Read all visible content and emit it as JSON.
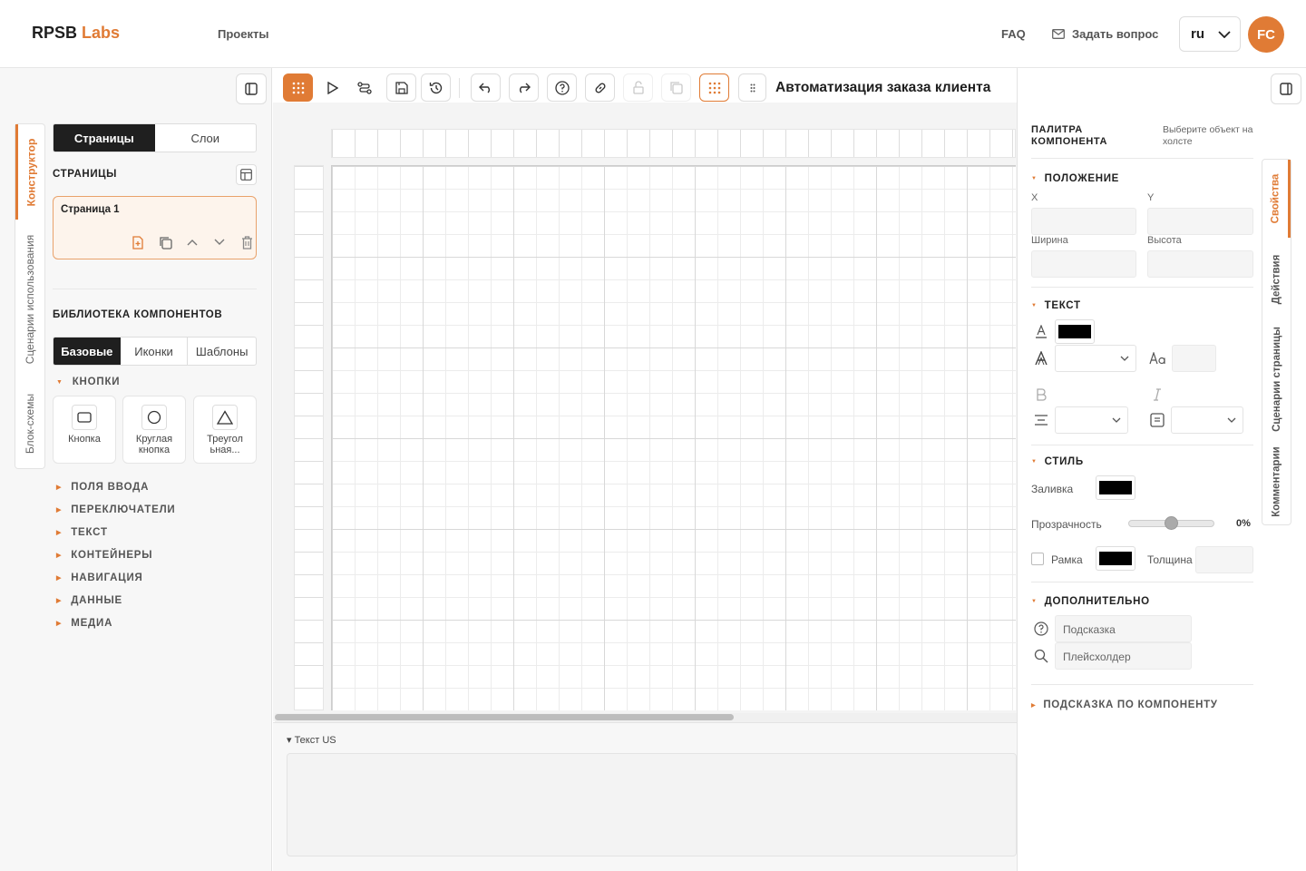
{
  "header": {
    "logo_main": "RPSB",
    "logo_accent": "Labs",
    "nav_projects": "Проекты",
    "faq": "FAQ",
    "ask": "Задать вопрос",
    "lang": "ru",
    "avatar": "FC"
  },
  "left": {
    "vtabs": [
      "Конструктор",
      "Сценарии использования",
      "Блок-схемы"
    ],
    "seg_pages": "Страницы",
    "seg_layers": "Слои",
    "pages_title": "СТРАНИЦЫ",
    "page1": "Страница 1",
    "library_title": "БИБЛИОТЕКА КОМПОНЕНТОВ",
    "lib_tabs": [
      "Базовые",
      "Иконки",
      "Шаблоны"
    ],
    "cat_buttons": "КНОПКИ",
    "components": [
      "Кнопка",
      "Круглая кнопка",
      "Треугол ьная..."
    ],
    "categories": [
      "ПОЛЯ ВВОДА",
      "ПЕРЕКЛЮЧАТЕЛИ",
      "ТЕКСТ",
      "КОНТЕЙНЕРЫ",
      "НАВИГАЦИЯ",
      "ДАННЫЕ",
      "МЕДИА"
    ]
  },
  "toolbar": {
    "title": "Автоматизация заказа клиента"
  },
  "bottom": {
    "us_label": "▾ Текст US"
  },
  "right": {
    "palette_title": "ПАЛИТРА КОМПОНЕНТА",
    "palette_hint": "Выберите объект на холсте",
    "position": "ПОЛОЖЕНИЕ",
    "x": "X",
    "y": "Y",
    "width": "Ширина",
    "height": "Высота",
    "text": "ТЕКСТ",
    "style": "СТИЛЬ",
    "fill": "Заливка",
    "opacity": "Прозрачность",
    "opacity_value": "0%",
    "border": "Рамка",
    "thickness": "Толщина",
    "extra": "ДОПОЛНИТЕЛЬНО",
    "tooltip": "Подсказка",
    "placeholder": "Плейсхолдер",
    "hint": "ПОДСКАЗКА ПО КОМПОНЕНТУ",
    "rtabs": [
      "Свойства",
      "Действия",
      "Сценарии страницы",
      "Комментарии"
    ],
    "fill_color": "#000000",
    "text_color": "#000000",
    "border_color": "#000000"
  },
  "colors": {
    "accent": "#e07b35",
    "dark": "#1f1f1f"
  }
}
